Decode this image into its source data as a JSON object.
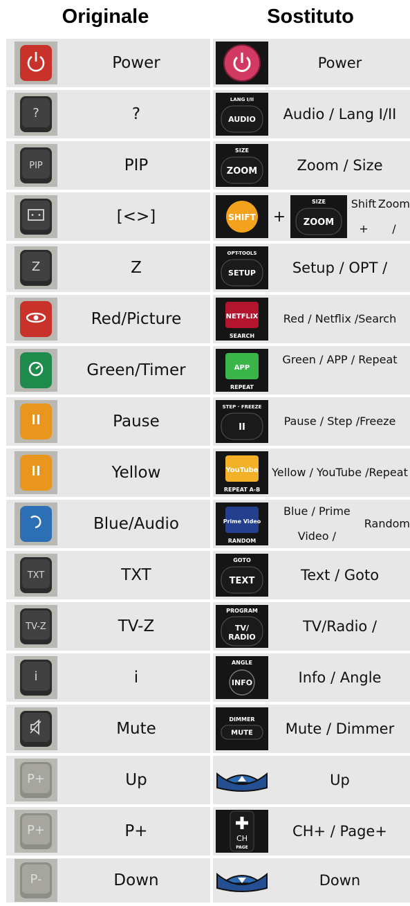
{
  "headers": {
    "left": "Originale",
    "right": "Sostituto"
  },
  "rows": [
    {
      "orig_label": "Power",
      "repl_label": "Power",
      "orig_icon": "red-power-button-icon",
      "repl_icon": "pink-power-button-icon",
      "orig_color": "#c8322a",
      "repl_color": "#d33a63"
    },
    {
      "orig_label": "?",
      "repl_label": "Audio / Lang I/II",
      "orig_icon": "question-button-icon",
      "repl_icon": "audio-lang-button-icon",
      "orig_key": "?",
      "repl_key": "AUDIO",
      "repl_key_top": "LANG I/II"
    },
    {
      "orig_label": "PIP",
      "repl_label": "Zoom / Size",
      "orig_icon": "pip-button-icon",
      "repl_icon": "zoom-size-button-icon",
      "orig_key": "PIP",
      "repl_key": "ZOOM",
      "repl_key_top": "SIZE"
    },
    {
      "orig_label": "[<>]",
      "repl_line1": "Shift +",
      "repl_line2": "Zoom /",
      "plus": "+",
      "orig_icon": "aspect-button-icon",
      "repl_icon": "shift-button-icon",
      "repl_key": "SHIFT",
      "repl_key2": "ZOOM",
      "repl_key2_top": "SIZE",
      "repl_color": "#f2a21c"
    },
    {
      "orig_label": "Z",
      "repl_label": "Setup / OPT /",
      "orig_icon": "z-button-icon",
      "repl_icon": "setup-button-icon",
      "orig_key": "Z",
      "repl_key": "SETUP",
      "repl_key_top": "OPT-TOOLS"
    },
    {
      "orig_label": "Red/Picture",
      "repl_line1": "Red / Netflix /",
      "repl_line2": "Search",
      "orig_icon": "red-eye-button-icon",
      "repl_icon": "netflix-button-icon",
      "repl_key": "NETFLIX",
      "repl_key_bottom": "SEARCH",
      "orig_color": "#c8322a",
      "repl_color": "#b3142e"
    },
    {
      "orig_label": "Green/Timer",
      "repl_line1": "Green / APP / Repeat",
      "repl_line2": "",
      "orig_icon": "green-timer-button-icon",
      "repl_icon": "app-button-icon",
      "repl_key": "APP",
      "repl_key_bottom": "REPEAT",
      "orig_color": "#1e8a4c",
      "repl_color": "#3ab54a"
    },
    {
      "orig_label": "Pause",
      "repl_line1": "Pause / Step /",
      "repl_line2": "Freeze",
      "orig_icon": "orange-pause-button-icon",
      "repl_icon": "step-freeze-button-icon",
      "repl_key": "II",
      "repl_key_top": "STEP · FREEZE",
      "orig_color": "#e8961e"
    },
    {
      "orig_label": "Yellow",
      "repl_line1": "Yellow / YouTube /",
      "repl_line2": "Repeat",
      "orig_icon": "yellow-pause-button-icon",
      "repl_icon": "youtube-button-icon",
      "repl_key": "YouTube",
      "repl_key_bottom": "REPEAT A-B",
      "orig_color": "#e8961e",
      "repl_color": "#f3b12a"
    },
    {
      "orig_label": "Blue/Audio",
      "repl_line1": "Blue / Prime Video /",
      "repl_line2": "Random",
      "orig_icon": "blue-audio-button-icon",
      "repl_icon": "prime-video-button-icon",
      "repl_key": "Prime Video",
      "repl_key_bottom": "RANDOM",
      "orig_color": "#2d6fb5",
      "repl_color": "#233f8e"
    },
    {
      "orig_label": "TXT",
      "repl_label": "Text / Goto",
      "orig_icon": "txt-button-icon",
      "repl_icon": "text-goto-button-icon",
      "orig_key": "TXT",
      "repl_key": "TEXT",
      "repl_key_top": "GOTO"
    },
    {
      "orig_label": "TV-Z",
      "repl_label": "TV/Radio /",
      "orig_icon": "tvz-button-icon",
      "repl_icon": "tv-radio-button-icon",
      "orig_key": "TV-Z",
      "repl_key": "TV/ RADIO",
      "repl_key_top": "PROGRAM"
    },
    {
      "orig_label": "i",
      "repl_label": "Info / Angle",
      "orig_icon": "info-button-icon",
      "repl_icon": "info-angle-button-icon",
      "orig_key": "i",
      "repl_key": "INFO",
      "repl_key_top": "ANGLE"
    },
    {
      "orig_label": "Mute",
      "repl_label": "Mute / Dimmer",
      "orig_icon": "mute-button-icon",
      "repl_icon": "mute-dimmer-button-icon",
      "repl_key": "MUTE",
      "repl_key_top": "DIMMER"
    },
    {
      "orig_label": "Up",
      "repl_label": "Up",
      "orig_icon": "p-plus-button-icon",
      "repl_icon": "up-arrow-button-icon",
      "orig_key": "P+"
    },
    {
      "orig_label": "P+",
      "repl_label": "CH+ / Page+",
      "orig_icon": "p-plus-button-icon",
      "repl_icon": "ch-plus-button-icon",
      "orig_key": "P+",
      "repl_key": "CH",
      "repl_key_bottom": "PAGE"
    },
    {
      "orig_label": "Down",
      "repl_label": "Down",
      "orig_icon": "p-minus-button-icon",
      "repl_icon": "down-arrow-button-icon",
      "orig_key": "P-"
    }
  ]
}
